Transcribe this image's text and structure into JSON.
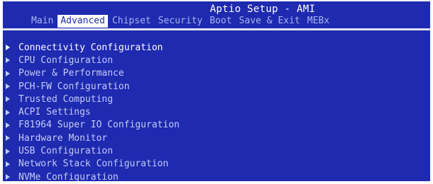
{
  "header": {
    "title": "Aptio Setup - AMI"
  },
  "tabs": [
    {
      "label": "Main",
      "active": false
    },
    {
      "label": "Advanced",
      "active": true
    },
    {
      "label": "Chipset",
      "active": false
    },
    {
      "label": "Security",
      "active": false
    },
    {
      "label": "Boot",
      "active": false
    },
    {
      "label": "Save & Exit",
      "active": false
    },
    {
      "label": "MEBx",
      "active": false
    }
  ],
  "menu": {
    "items": [
      {
        "label": "Connectivity Configuration",
        "selected": true
      },
      {
        "label": "CPU Configuration",
        "selected": false
      },
      {
        "label": "Power & Performance",
        "selected": false
      },
      {
        "label": "PCH-FW Configuration",
        "selected": false
      },
      {
        "label": "Trusted Computing",
        "selected": false
      },
      {
        "label": "ACPI Settings",
        "selected": false
      },
      {
        "label": "F81964 Super IO Configuration",
        "selected": false
      },
      {
        "label": "Hardware Monitor",
        "selected": false
      },
      {
        "label": "USB Configuration",
        "selected": false
      },
      {
        "label": "Network Stack Configuration",
        "selected": false
      },
      {
        "label": "NVMe Configuration",
        "selected": false
      }
    ]
  },
  "colors": {
    "background": "#1e2ab0",
    "active_tab_bg": "#ffffff",
    "selected_text": "#ffffff",
    "menu_text": "#c4cbf5",
    "tab_text": "#aab3ee"
  },
  "icons": {
    "submenu": "submenu-arrow-icon"
  }
}
